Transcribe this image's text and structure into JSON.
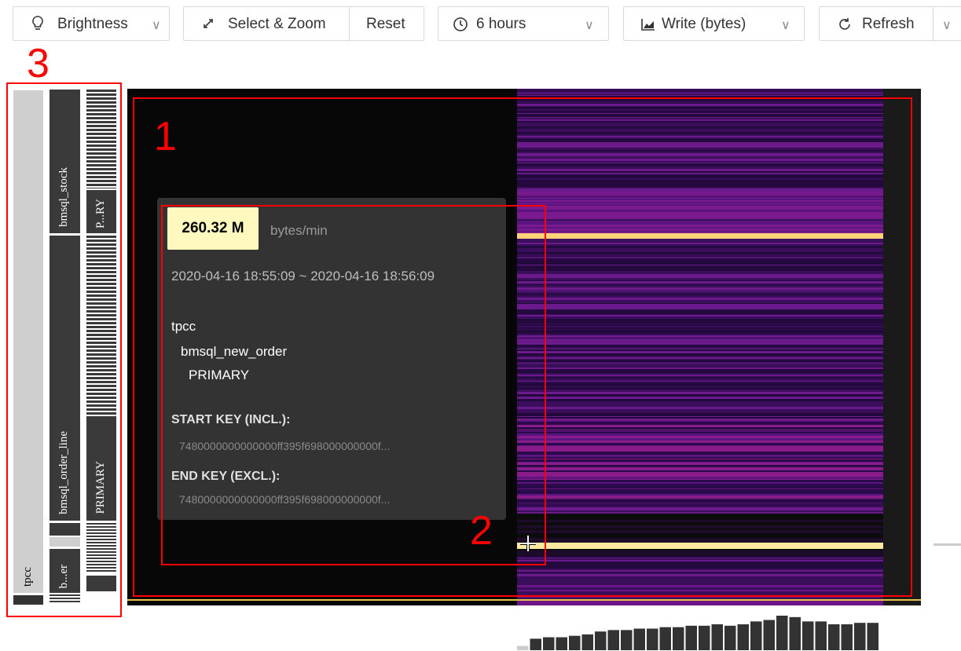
{
  "toolbar": {
    "brightness_label": "Brightness",
    "select_zoom_label": "Select & Zoom",
    "reset_label": "Reset",
    "time_range_label": "6 hours",
    "metric_label": "Write (bytes)",
    "refresh_label": "Refresh"
  },
  "annotations": {
    "heatmap_num": "1",
    "tooltip_num": "2",
    "axis_num": "3"
  },
  "tooltip": {
    "value": "260.32 M",
    "unit": "bytes/min",
    "time_range": "2020-04-16 18:55:09 ~ 2020-04-16 18:56:09",
    "db": "tpcc",
    "table": "bmsql_new_order",
    "index": "PRIMARY",
    "start_key_title": "START KEY (INCL.):",
    "start_key_value": "7480000000000000ff395f698000000000f...",
    "end_key_title": "END KEY (EXCL.):",
    "end_key_value": "7480000000000000ff395f698000000000f..."
  },
  "axis": {
    "db_label": "tpcc",
    "table_stock": "bmsql_stock",
    "table_order_line": "bmsql_order_line",
    "table_short": "b...er",
    "index_short": "P...RY",
    "index_primary": "PRIMARY"
  },
  "colors": {
    "annotation": "#ff0000",
    "highlight": "#fff9c0",
    "heat_low": "#2a0a4a",
    "heat_high": "#ffe9a0"
  },
  "histogram_values": [
    3,
    8,
    9,
    9,
    10,
    11,
    13,
    14,
    14,
    15,
    15,
    16,
    16,
    17,
    17,
    18,
    17,
    18,
    20,
    21,
    24,
    23,
    20,
    20,
    18,
    18,
    19,
    19
  ]
}
